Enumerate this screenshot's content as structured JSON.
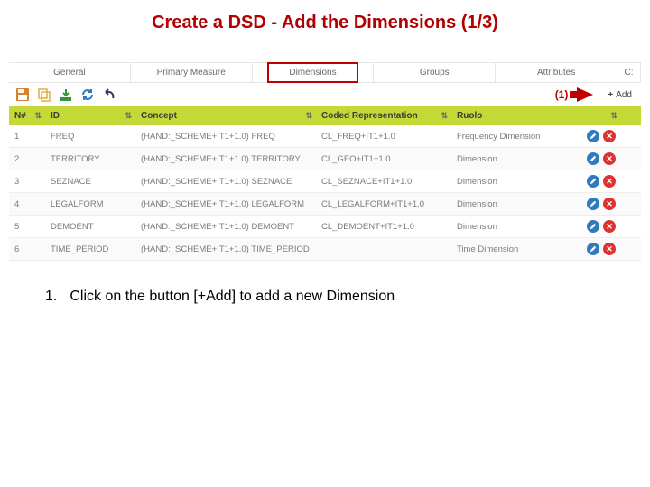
{
  "title": "Create a DSD - Add the Dimensions (1/3)",
  "tabs": [
    "General",
    "Primary Measure",
    "Dimensions",
    "Groups",
    "Attributes",
    "C:"
  ],
  "active_tab": "Dimensions",
  "marker": "(1)",
  "add_button": {
    "plus": "+",
    "label": "Add"
  },
  "toolbar_icons": {
    "save": "save-icon",
    "copy": "copy-icon",
    "download": "download-icon",
    "sync": "sync-icon",
    "undo": "undo-icon"
  },
  "columns": {
    "n": "N#",
    "id": "ID",
    "concept": "Concept",
    "coded": "Coded Representation",
    "role": "Ruolo",
    "actions": ""
  },
  "rows": [
    {
      "n": "1",
      "id": "FREQ",
      "concept": "(HAND:_SCHEME+IT1+1.0) FREQ",
      "coded": "CL_FREQ+IT1+1.0",
      "role": "Frequency Dimension"
    },
    {
      "n": "2",
      "id": "TERRITORY",
      "concept": "(HAND:_SCHEME+IT1+1.0) TERRITORY",
      "coded": "CL_GEO+IT1+1.0",
      "role": "Dimension"
    },
    {
      "n": "3",
      "id": "SEZNACE",
      "concept": "(HAND:_SCHEME+IT1+1.0) SEZNACE",
      "coded": "CL_SEZNACE+IT1+1.0",
      "role": "Dimension"
    },
    {
      "n": "4",
      "id": "LEGALFORM",
      "concept": "(HAND:_SCHEME+IT1+1.0) LEGALFORM",
      "coded": "CL_LEGALFORM+IT1+1.0",
      "role": "Dimension"
    },
    {
      "n": "5",
      "id": "DEMOENT",
      "concept": "(HAND:_SCHEME+IT1+1.0) DEMOENT",
      "coded": "CL_DEMOENT+IT1+1.0",
      "role": "Dimension"
    },
    {
      "n": "6",
      "id": "TIME_PERIOD",
      "concept": "(HAND:_SCHEME+IT1+1.0) TIME_PERIOD",
      "coded": "",
      "role": "Time Dimension"
    }
  ],
  "instruction": {
    "num": "1.",
    "text": "Click on the button [+Add] to add a new Dimension"
  }
}
